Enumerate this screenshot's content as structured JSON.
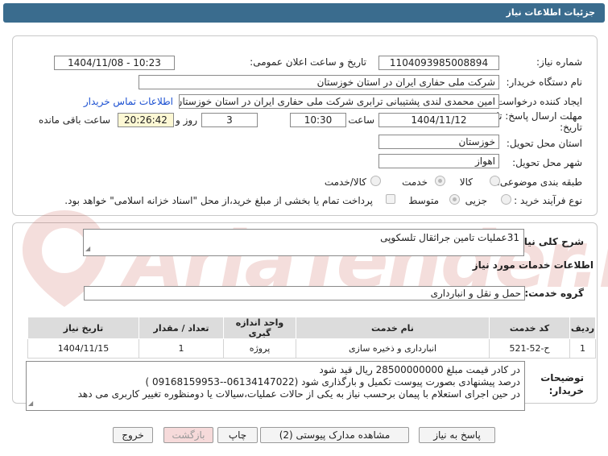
{
  "header": {
    "title": "جزئیات اطلاعات نیاز"
  },
  "watermark": {
    "text": "AriaTender.net"
  },
  "form": {
    "need_number_label": "شماره نیاز:",
    "need_number": "1104093985008894",
    "announce_label": "تاریخ و ساعت اعلان عمومی:",
    "announce_value": "1404/11/08 - 10:23",
    "buyer_label": "نام دستگاه خریدار:",
    "buyer_value": "شرکت ملی حفاری ایران در استان خوزستان",
    "creator_label": "ایجاد کننده درخواست:",
    "creator_value": "امین محمدی لندی پشتیبانی ترابری شرکت ملی حفاری ایران در استان خوزستان",
    "contact_link": "اطلاعات تماس خریدار",
    "deadline_label": "مهلت ارسال پاسخ: تا تاریخ:",
    "deadline_date": "1404/11/12",
    "time_label": "ساعت",
    "deadline_time": "10:30",
    "days_value": "3",
    "days_label": "روز و",
    "remaining_time": "20:26:42",
    "remaining_label": "ساعت باقی مانده",
    "province_label": "استان محل تحویل:",
    "province_value": "خوزستان",
    "city_label": "شهر محل تحویل:",
    "city_value": "اهواز",
    "category_label": "طبقه بندی موضوعی:",
    "category_options": [
      "کالا",
      "خدمت",
      "کالا/خدمت"
    ],
    "process_label": "نوع فرآیند خرید :",
    "process_options": [
      "جزیی",
      "متوسط"
    ],
    "payment_text": "پرداخت تمام یا بخشی از مبلغ خرید،از محل \"اسناد خزانه اسلامی\" خواهد بود."
  },
  "details": {
    "summary_label": "شرح کلی نیاز:",
    "summary_value": "31عملیات تامین جراثقال تلسکوپی",
    "services_heading": "اطلاعات خدمات مورد نیاز",
    "service_group_label": "گروه خدمت:",
    "service_group_value": "حمل و نقل و انبارداری",
    "table": {
      "headers": [
        "ردیف",
        "کد خدمت",
        "نام خدمت",
        "واحد اندازه گیری",
        "تعداد / مقدار",
        "تاریخ نیاز"
      ],
      "rows": [
        [
          "1",
          "ح-52-521",
          "انبارداری و ذخیره سازی",
          "پروژه",
          "1",
          "1404/11/15"
        ]
      ]
    },
    "buyer_notes_label": "توضیحات خریدار:",
    "buyer_notes": [
      "در کادر قیمت مبلغ 28500000000 ریال قید شود",
      "درصد پیشنهادی بصورت پیوست تکمیل و بارگذاری شود (06134147022--09168159953 )",
      "در حین اجرای استعلام با پیمان برحسب نیاز به یکی از حالات عملیات،سیالات یا دومنظوره تغییر کاربری می دهد"
    ]
  },
  "actions": {
    "reply": "پاسخ به نیاز",
    "attachments": "مشاهده مدارک پیوستی (2)",
    "print": "چاپ",
    "back": "بازگشت",
    "exit": "خروج"
  }
}
